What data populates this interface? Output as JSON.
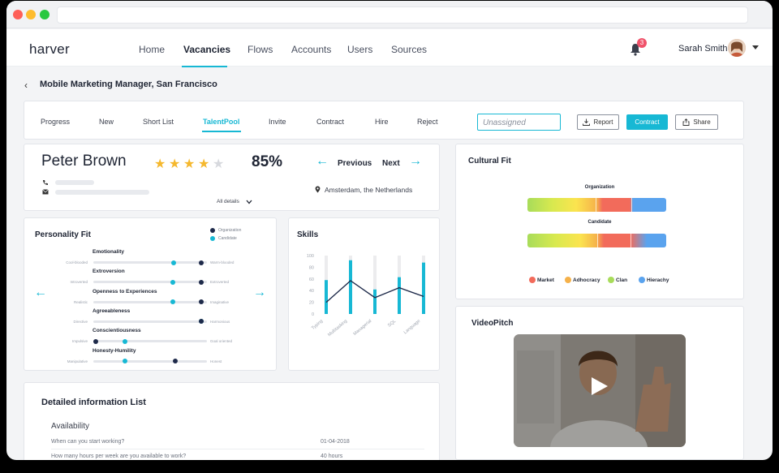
{
  "header": {
    "logo": "harver",
    "nav": [
      {
        "label": "Home",
        "active": false
      },
      {
        "label": "Vacancies",
        "active": true
      },
      {
        "label": "Flows",
        "active": false
      },
      {
        "label": "Accounts",
        "active": false
      },
      {
        "label": "Users",
        "active": false
      },
      {
        "label": "Sources",
        "active": false
      }
    ],
    "notification_count": "3",
    "user_name": "Sarah Smith"
  },
  "page": {
    "title": "Mobile Marketing Manager, San Francisco"
  },
  "stages": {
    "items": [
      "Progress",
      "New",
      "Short List",
      "TalentPool",
      "Invite",
      "Contract",
      "Hire",
      "Reject"
    ],
    "active": "TalentPool",
    "assign_placeholder": "Unassigned",
    "report_label": "Report",
    "contract_label": "Contract",
    "share_label": "Share"
  },
  "candidate": {
    "name": "Peter Brown",
    "rating": 4,
    "rating_max": 5,
    "match": "85%",
    "previous_label": "Previous",
    "next_label": "Next",
    "location": "Amsterdam, the Netherlands",
    "all_details_label": "All details"
  },
  "personality": {
    "title": "Personality Fit",
    "legend_org": "Organization",
    "legend_cand": "Candidate",
    "org_color": "#1e2a4a",
    "cand_color": "#17b8d4",
    "traits": [
      {
        "name": "Emotionality",
        "left": "Cool-blooded",
        "right": "Warm-blooded",
        "org": 0.97,
        "cand": 0.72
      },
      {
        "name": "Extroversion",
        "left": "Introverted",
        "right": "Extroverted",
        "org": 0.97,
        "cand": 0.71
      },
      {
        "name": "Openness to Experiences",
        "left": "Realistic",
        "right": "Imaginative",
        "org": 0.97,
        "cand": 0.71
      },
      {
        "name": "Agreeableness",
        "left": "Directive",
        "right": "Harmonious",
        "org": 0.97,
        "cand": 0.97
      },
      {
        "name": "Conscientiousness",
        "left": "Impulsive",
        "right": "Goal oriented",
        "org": 0.0,
        "cand": 0.27
      },
      {
        "name": "Honesty-Humility",
        "left": "Manipulative",
        "right": "Honest",
        "org": 0.73,
        "cand": 0.27
      }
    ]
  },
  "skills": {
    "title": "Skills",
    "chart_data": {
      "type": "bar",
      "categories": [
        "Typing",
        "Multitasking",
        "Managerial",
        "SQL",
        "Language"
      ],
      "values": [
        58,
        92,
        42,
        63,
        88
      ],
      "line_values": [
        20,
        57,
        28,
        45,
        30
      ],
      "yticks": [
        0,
        20,
        40,
        60,
        80,
        100
      ],
      "ylim": [
        0,
        100
      ],
      "bar_color": "#17b8d4",
      "line_color": "#1e2a4a"
    }
  },
  "cultural": {
    "title": "Cultural Fit",
    "org_label": "Organization",
    "cand_label": "Candidate",
    "legend": [
      {
        "label": "Market",
        "color": "#f26b5b"
      },
      {
        "label": "Adhocracy",
        "color": "#f5b14a"
      },
      {
        "label": "Clan",
        "color": "#a8dc5a"
      },
      {
        "label": "Hierachy",
        "color": "#5aa3ee"
      }
    ]
  },
  "video": {
    "title": "VideoPitch"
  },
  "details": {
    "title": "Detailed information List",
    "section": "Availability",
    "rows": [
      {
        "q": "When can you start working?",
        "a": "01-04-2018"
      },
      {
        "q": "How many hours per week are you available to work?",
        "a": "40 hours"
      }
    ]
  }
}
